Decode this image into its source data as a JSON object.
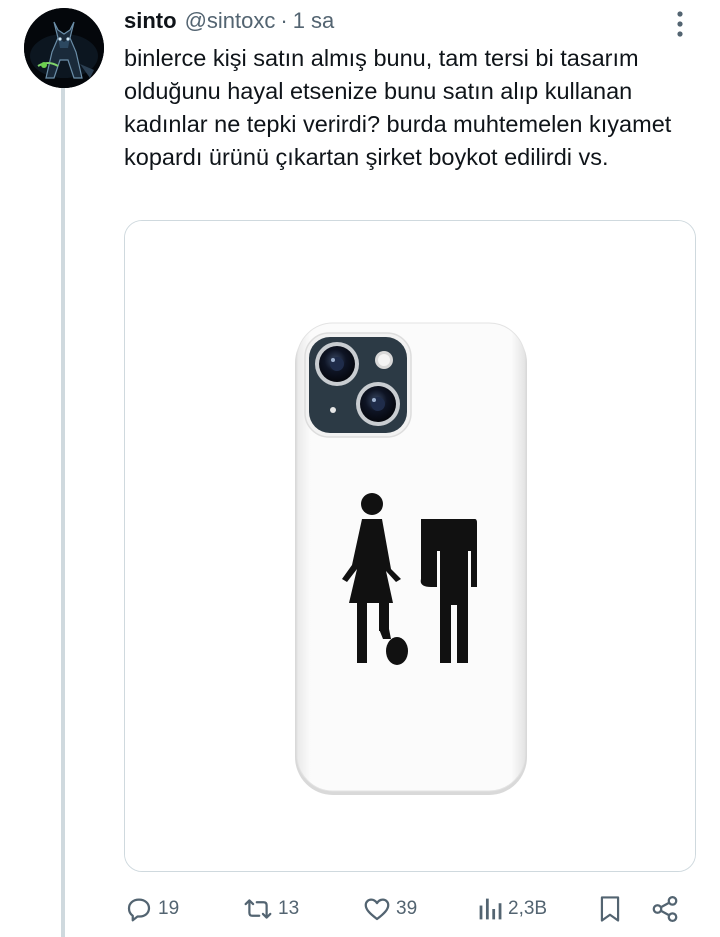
{
  "tweet": {
    "author": {
      "name": "sinto",
      "handle": "@sintoxc",
      "time": "1 sa",
      "separator": "·"
    },
    "text": "binlerce kişi satın almış bunu, tam tersi bi tasarım olduğunu hayal etsenize bunu satın alıp kullanan kadınlar ne tepki verirdi? burda muhtemelen kıyamet kopardı ürünü çıkartan şirket boykot edilirdi vs.",
    "icons": {
      "more": "more-vertical-icon",
      "reply": "reply-icon",
      "retweet": "retweet-icon",
      "like": "like-icon",
      "views": "views-icon",
      "bookmark": "bookmark-icon",
      "share": "share-icon"
    },
    "stats": {
      "replies": "19",
      "retweets": "13",
      "likes": "39",
      "views": "2,3B"
    },
    "colors": {
      "text": "#0f1419",
      "secondary": "#536471",
      "border": "#cfd9de"
    }
  }
}
